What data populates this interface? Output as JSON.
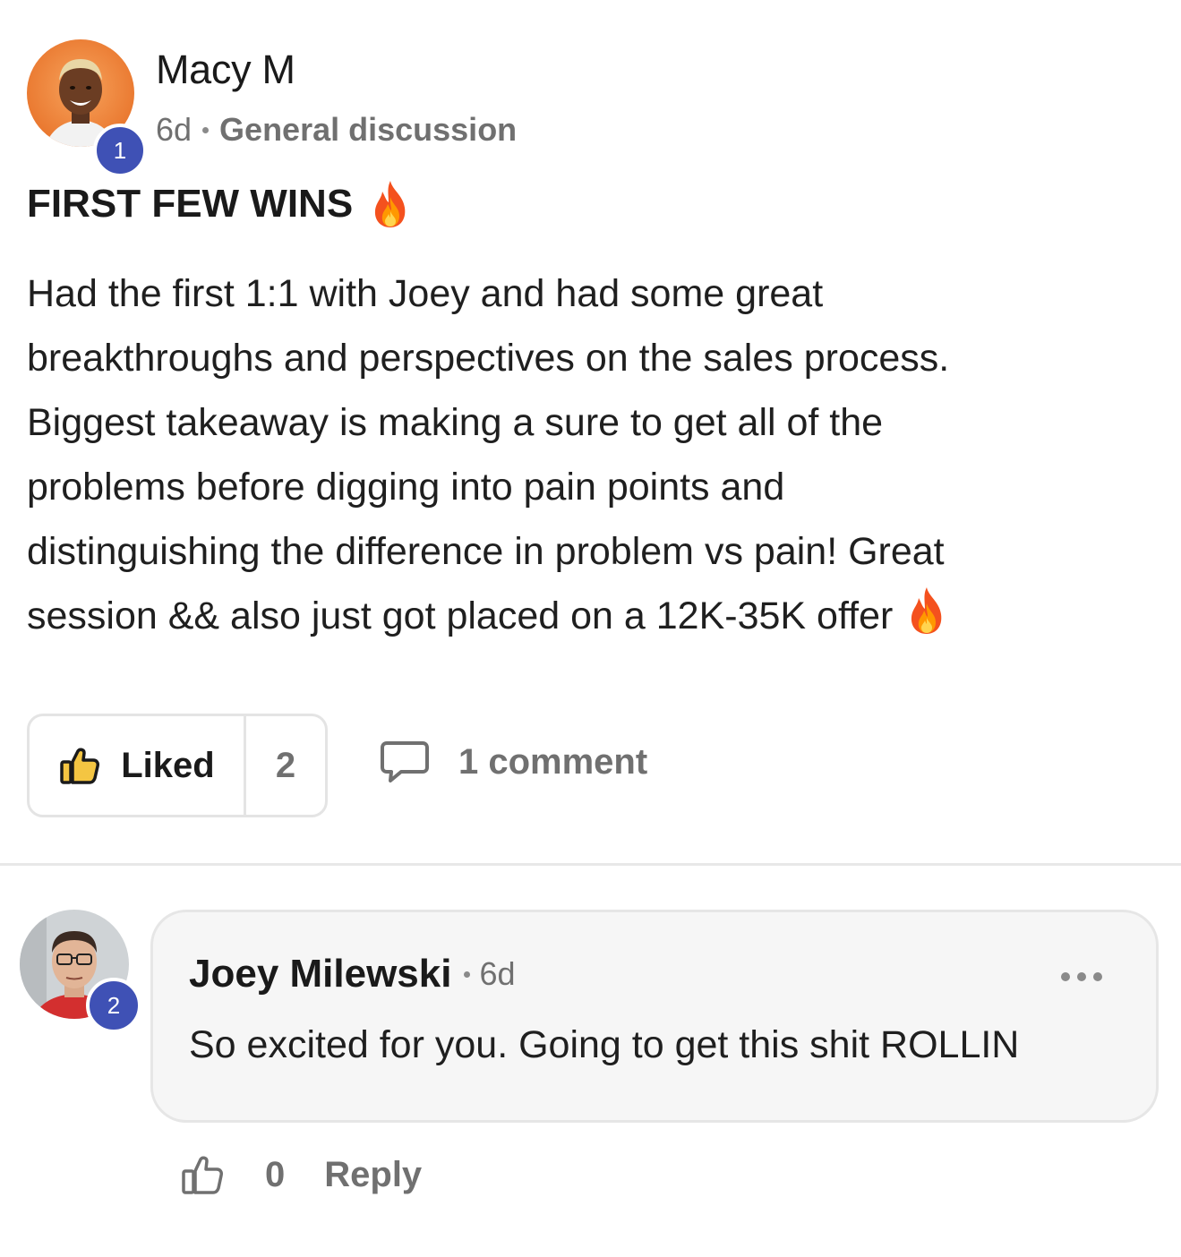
{
  "post": {
    "author": {
      "name": "Macy M",
      "level": "1",
      "avatar_icon": "user-avatar-photo"
    },
    "time_ago": "6d",
    "category": "General discussion",
    "title": "FIRST FEW WINS",
    "title_emoji": "fire-emoji",
    "body_lines": [
      "Had the first 1:1 with Joey and had some great",
      "breakthroughs and perspectives on the sales process.",
      "Biggest takeaway is making a sure to get all of the",
      "problems before digging into pain points and",
      "distinguishing the difference in problem vs pain! Great",
      "session && also just got placed on a 12K-35K offer"
    ],
    "body_end_emoji": "fire-emoji",
    "actions": {
      "like_label": "Liked",
      "like_count": "2",
      "liked": true,
      "comment_count_label": "1 comment"
    }
  },
  "comment": {
    "author": {
      "name": "Joey Milewski",
      "level": "2",
      "avatar_icon": "user-avatar-photo"
    },
    "time_ago": "6d",
    "text": "So excited for you. Going to get this shit ROLLIN",
    "like_count": "0",
    "reply_label": "Reply"
  },
  "colors": {
    "level_badge": "#3f51b5",
    "muted_text": "#707070",
    "primary_text": "#1a1a1a",
    "bubble_bg": "#f6f6f6",
    "border": "#e4e4e4"
  }
}
